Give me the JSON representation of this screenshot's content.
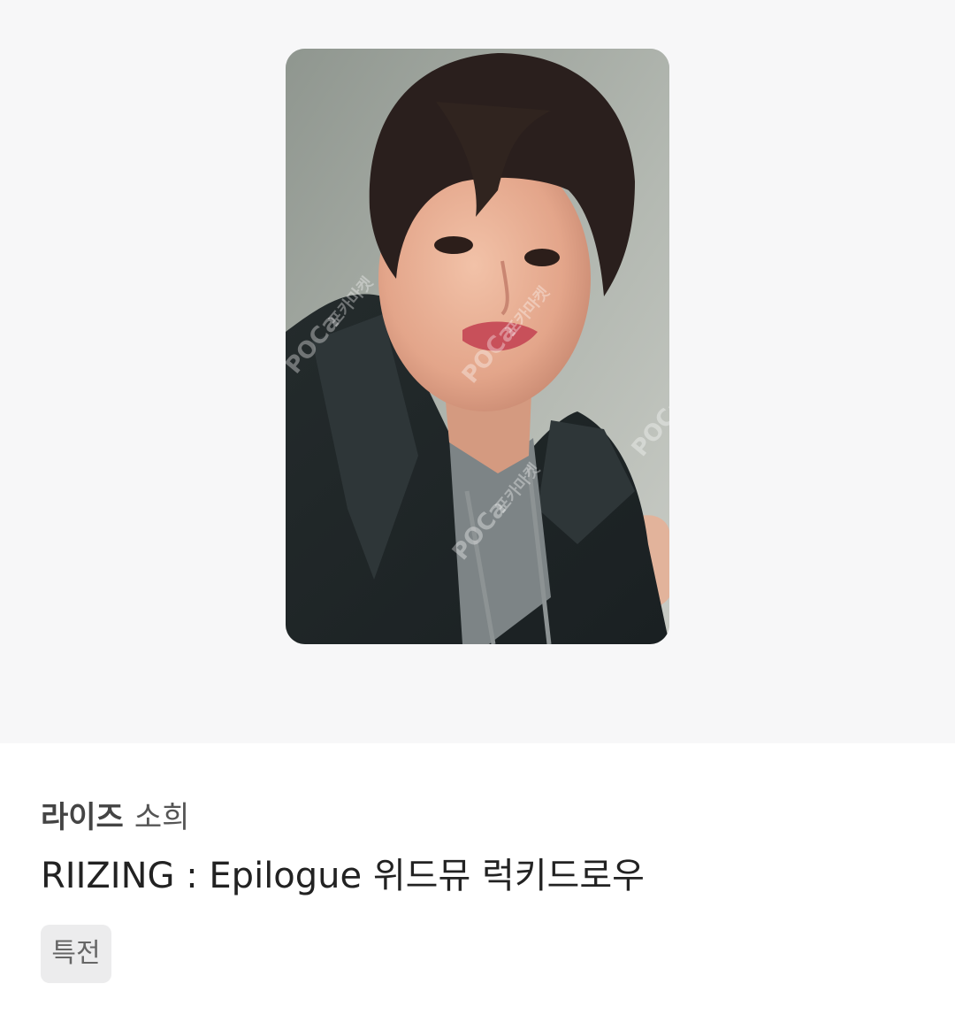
{
  "product": {
    "image_alt": "photocard",
    "watermark": {
      "brand": "POCa",
      "korean": "포카마켓"
    }
  },
  "info": {
    "artist": "라이즈",
    "member": "소희",
    "title": "RIIZING : Epilogue 위드뮤 럭키드로우",
    "tag": "특전"
  }
}
